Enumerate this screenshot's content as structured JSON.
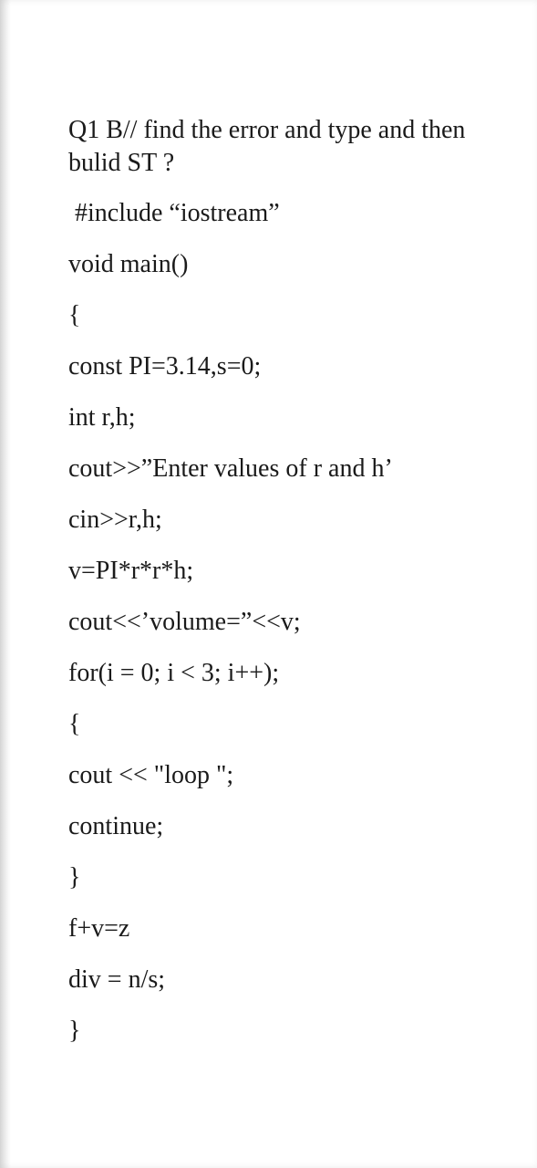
{
  "question": {
    "header": "Q1 B// find the error and type and then bulid ST ?"
  },
  "code": {
    "lines": [
      " #include “iostream”",
      "void main()",
      "{",
      "const PI=3.14,s=0;",
      "int r,h;",
      "cout>>”Enter values of r and h’",
      "cin>>r,h;",
      "v=PI*r*r*h;",
      "cout<<’volume=”<<v;",
      "for(i = 0; i < 3; i++);",
      "{",
      "cout << \"loop \";",
      "continue;",
      "}",
      "f+v=z",
      "div = n/s;",
      "}"
    ]
  }
}
